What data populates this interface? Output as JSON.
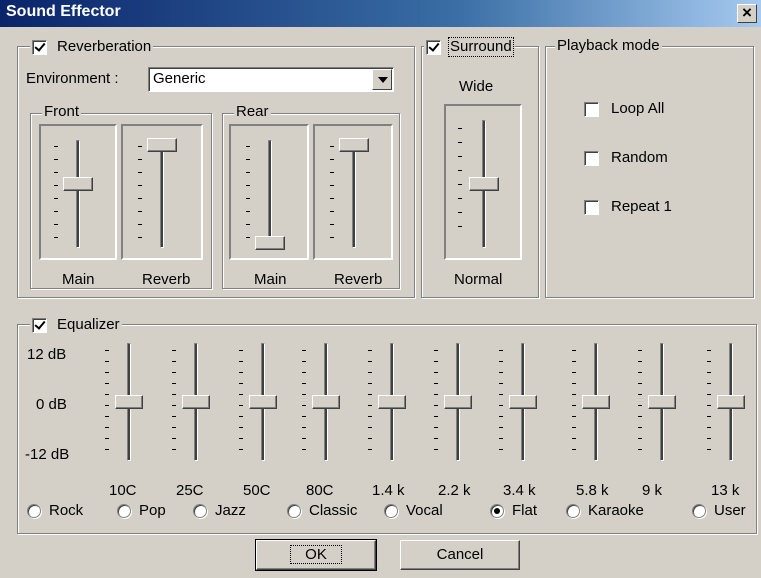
{
  "window": {
    "title": "Sound Effector",
    "close_label": "×"
  },
  "reverberation": {
    "label": "Reverberation",
    "checked": true,
    "environment_label": "Environment :",
    "environment_value": "Generic",
    "front": {
      "label": "Front",
      "main_label": "Main",
      "reverb_label": "Reverb",
      "main_level": 0.6,
      "reverb_level": 1.0
    },
    "rear": {
      "label": "Rear",
      "main_label": "Main",
      "reverb_label": "Reverb",
      "main_level": 0.0,
      "reverb_level": 1.0
    }
  },
  "surround": {
    "label": "Surround",
    "checked": true,
    "top_label": "Wide",
    "bottom_label": "Normal",
    "level": 0.5
  },
  "playback": {
    "label": "Playback mode",
    "options": [
      {
        "label": "Loop All",
        "checked": false
      },
      {
        "label": "Random",
        "checked": false
      },
      {
        "label": "Repeat 1",
        "checked": false
      }
    ]
  },
  "equalizer": {
    "label": "Equalizer",
    "checked": true,
    "scale": {
      "top": "12 dB",
      "mid": "0 dB",
      "bottom": "-12 dB"
    },
    "bands": [
      {
        "freq": "10C",
        "gain_db": 0
      },
      {
        "freq": "25C",
        "gain_db": 0
      },
      {
        "freq": "50C",
        "gain_db": 0
      },
      {
        "freq": "80C",
        "gain_db": 0
      },
      {
        "freq": "1.4 k",
        "gain_db": 0
      },
      {
        "freq": "2.2 k",
        "gain_db": 0
      },
      {
        "freq": "3.4 k",
        "gain_db": 0
      },
      {
        "freq": "5.8 k",
        "gain_db": 0
      },
      {
        "freq": "9 k",
        "gain_db": 0
      },
      {
        "freq": "13 k",
        "gain_db": 0
      }
    ],
    "presets": [
      {
        "label": "Rock",
        "selected": false
      },
      {
        "label": "Pop",
        "selected": false
      },
      {
        "label": "Jazz",
        "selected": false
      },
      {
        "label": "Classic",
        "selected": false
      },
      {
        "label": "Vocal",
        "selected": false
      },
      {
        "label": "Flat",
        "selected": true
      },
      {
        "label": "Karaoke",
        "selected": false
      },
      {
        "label": "User",
        "selected": false
      }
    ]
  },
  "buttons": {
    "ok": "OK",
    "cancel": "Cancel"
  }
}
